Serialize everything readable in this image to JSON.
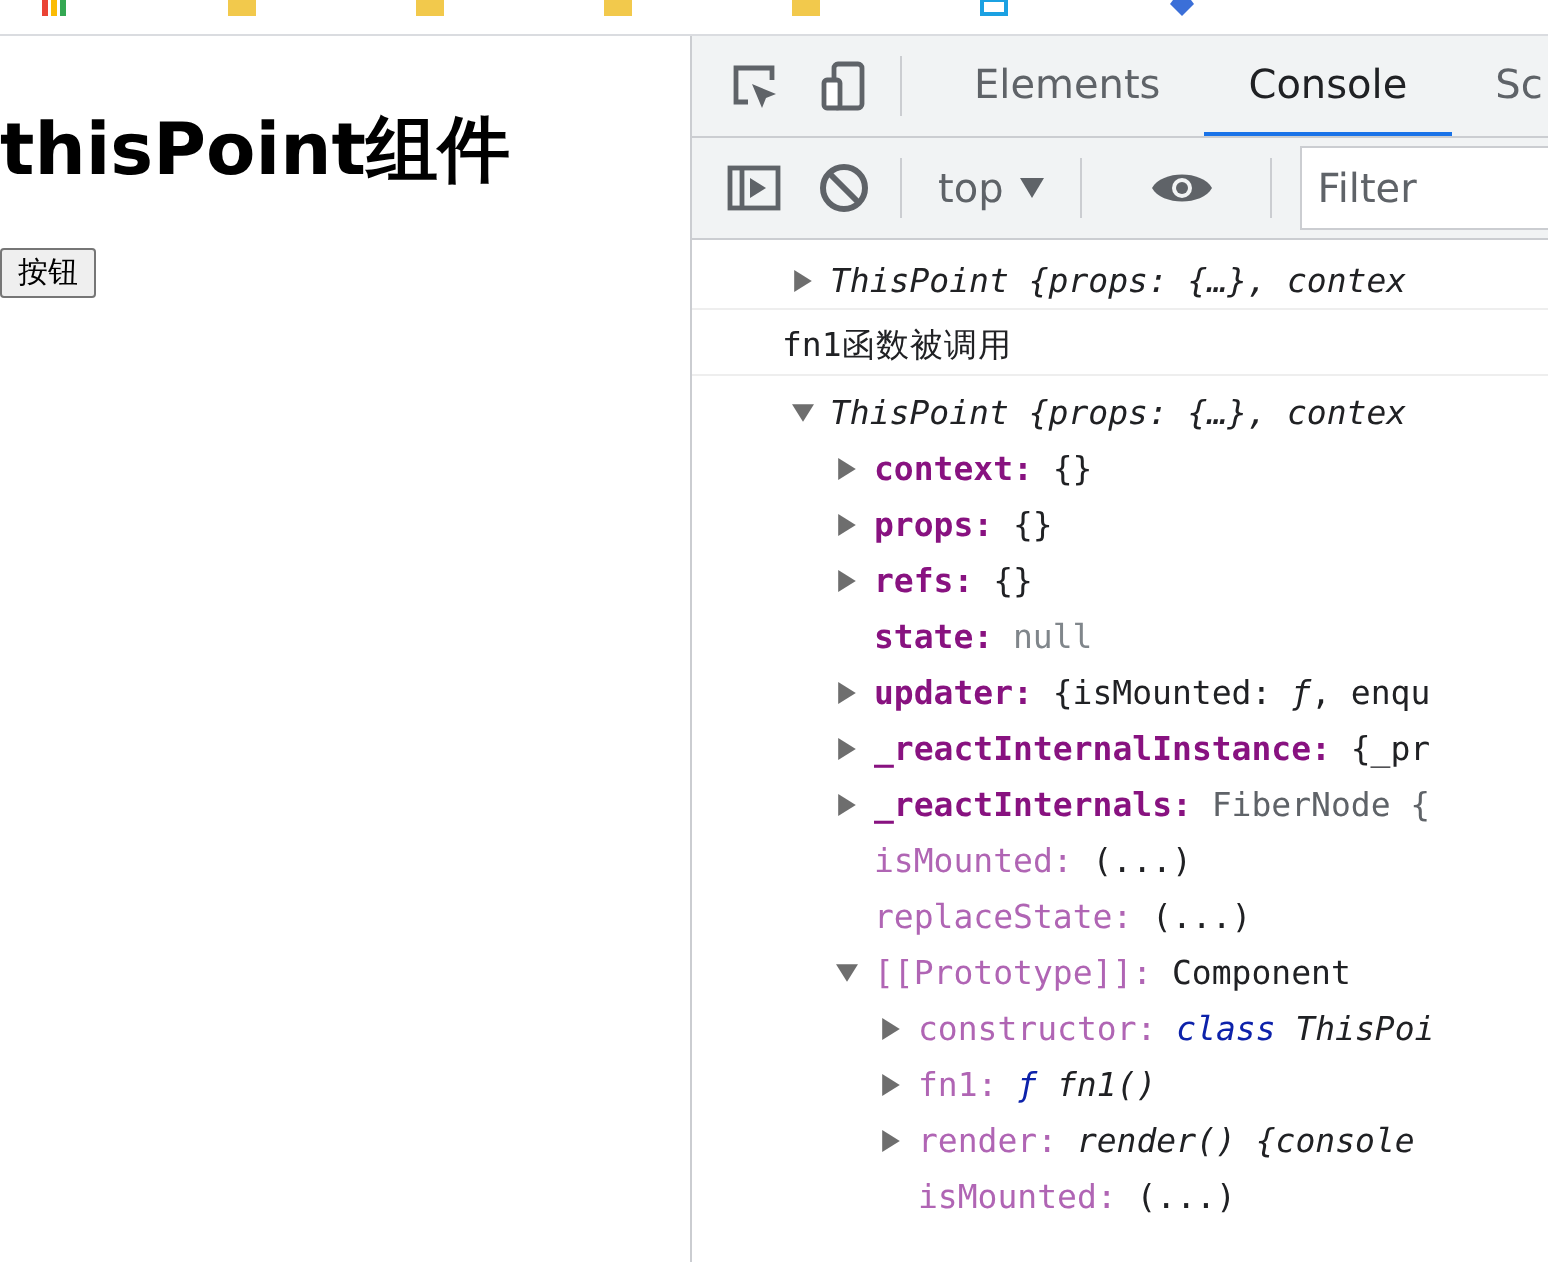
{
  "bookmarks_bar": {
    "items": [
      {
        "kind": "apps"
      },
      {
        "kind": "folder"
      },
      {
        "kind": "folder"
      },
      {
        "kind": "folder"
      },
      {
        "kind": "folder"
      },
      {
        "kind": "page"
      },
      {
        "kind": "diamond"
      }
    ]
  },
  "page": {
    "heading": "thisPoint组件",
    "button": "按钮"
  },
  "devtools": {
    "tabs": [
      {
        "label": "Elements",
        "selected": false
      },
      {
        "label": "Console",
        "selected": true
      },
      {
        "label": "Sc",
        "selected": false
      }
    ],
    "context": "top",
    "filter": {
      "placeholder": "Filter"
    },
    "console": [
      {
        "kind": "object",
        "expanded": false,
        "summary": "ThisPoint {props: {…}, contex"
      },
      {
        "kind": "log",
        "text": "fn1函数被调用"
      },
      {
        "kind": "object",
        "expanded": true,
        "summary": "ThisPoint {props: {…}, contex",
        "children": [
          {
            "key": "context:",
            "enumerable": true,
            "expandable": true,
            "expanded": false,
            "value": "{}",
            "kind": "plain"
          },
          {
            "key": "props:",
            "enumerable": true,
            "expandable": true,
            "expanded": false,
            "value": "{}",
            "kind": "plain"
          },
          {
            "key": "refs:",
            "enumerable": true,
            "expandable": true,
            "expanded": false,
            "value": "{}",
            "kind": "plain"
          },
          {
            "key": "state:",
            "enumerable": true,
            "expandable": false,
            "value": "null",
            "kind": "null"
          },
          {
            "key": "updater:",
            "enumerable": true,
            "expandable": true,
            "expanded": false,
            "value": "{isMounted: *ƒ*, enqu",
            "kind": "plain"
          },
          {
            "key": "_reactInternalInstance:",
            "enumerable": true,
            "expandable": true,
            "expanded": false,
            "value": "{_pr",
            "kind": "plain"
          },
          {
            "key": "_reactInternals:",
            "enumerable": true,
            "expandable": true,
            "expanded": false,
            "value": "FiberNode {",
            "kind": "type"
          },
          {
            "key": "isMounted:",
            "enumerable": false,
            "expandable": false,
            "value": "(...)",
            "kind": "plain"
          },
          {
            "key": "replaceState:",
            "enumerable": false,
            "expandable": false,
            "value": "(...)",
            "kind": "plain"
          },
          {
            "key": "[[Prototype]]:",
            "enumerable": false,
            "expandable": true,
            "expanded": true,
            "value": "Component",
            "kind": "plain",
            "children": [
              {
                "key": "constructor:",
                "enumerable": false,
                "expandable": true,
                "expanded": false,
                "prefix": "class",
                "value": "ThisPoi",
                "kind": "function"
              },
              {
                "key": "fn1:",
                "enumerable": false,
                "expandable": true,
                "expanded": false,
                "prefix": "ƒ",
                "value": "fn1()",
                "kind": "function"
              },
              {
                "key": "render:",
                "enumerable": false,
                "expandable": true,
                "expanded": false,
                "value": "render() {console",
                "kind": "function"
              },
              {
                "key": "isMounted:",
                "enumerable": false,
                "expandable": false,
                "value": "(...)",
                "kind": "plain"
              }
            ]
          }
        ]
      }
    ]
  }
}
